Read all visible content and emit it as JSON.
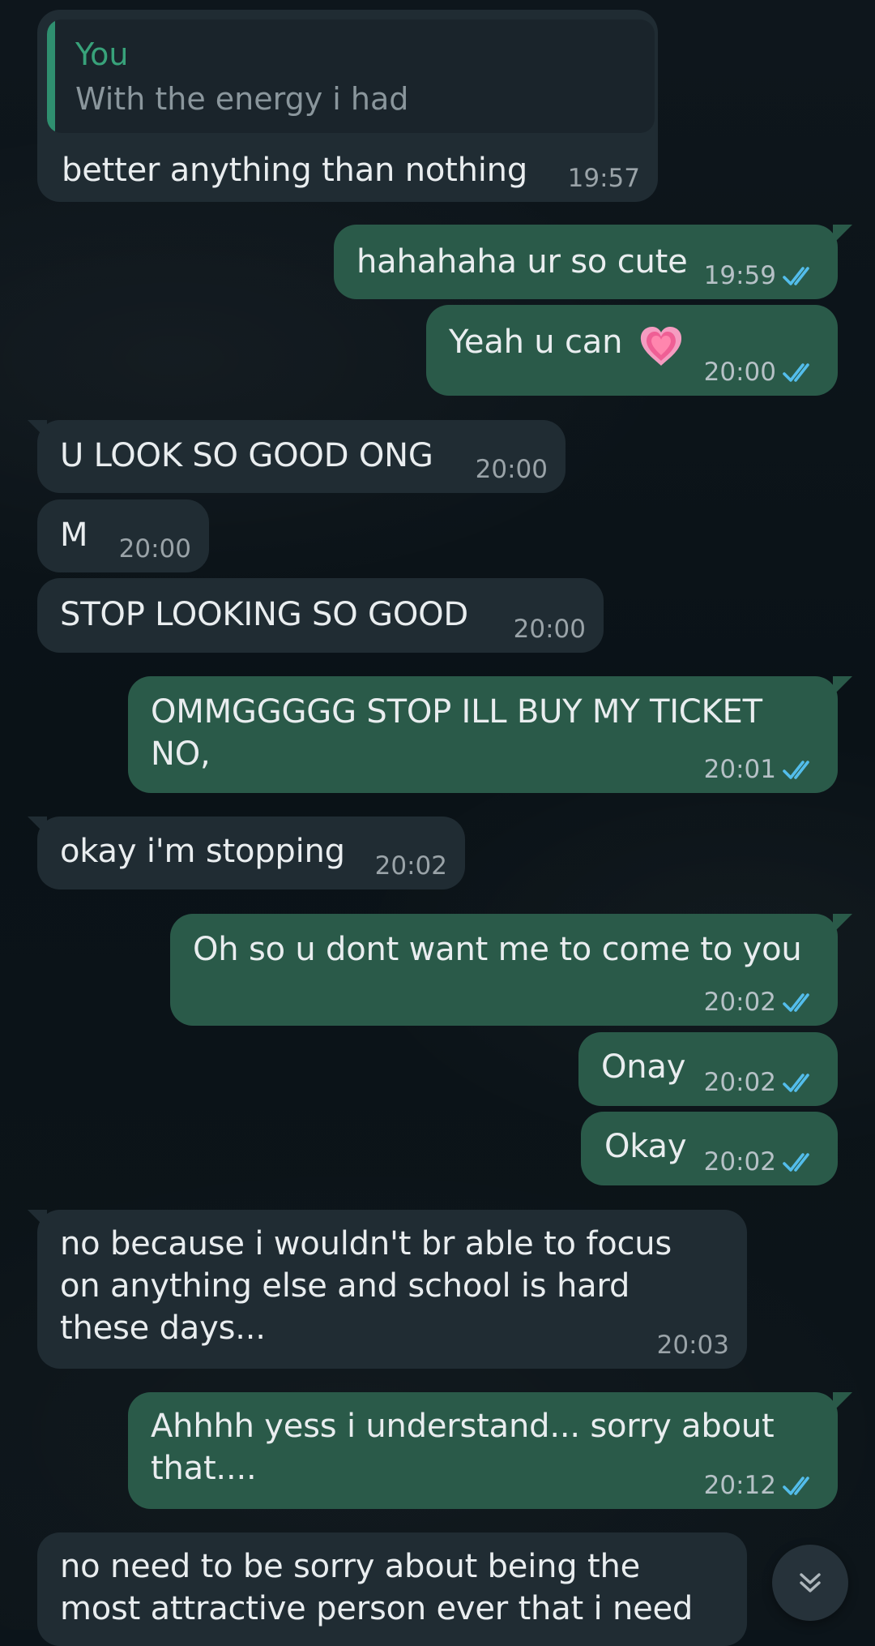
{
  "messages": [
    {
      "direction": "incoming",
      "reply": {
        "name": "You",
        "text": "With the energy i had"
      },
      "text": "better anything than nothing",
      "time": "19:57"
    },
    {
      "direction": "outgoing",
      "text": "hahahaha ur so cute",
      "time": "19:59",
      "status": "read"
    },
    {
      "direction": "outgoing",
      "text": "Yeah u can",
      "emoji": "growing-heart",
      "time": "20:00",
      "status": "read"
    },
    {
      "direction": "incoming",
      "text": "U LOOK SO GOOD ONG",
      "time": "20:00"
    },
    {
      "direction": "incoming",
      "text": "M",
      "time": "20:00"
    },
    {
      "direction": "incoming",
      "text": "STOP LOOKING SO GOOD",
      "time": "20:00"
    },
    {
      "direction": "outgoing",
      "text": "OMMGGGGG STOP ILL BUY MY TICKET\nNO,",
      "time": "20:01",
      "status": "read"
    },
    {
      "direction": "incoming",
      "text": "okay i'm stopping",
      "time": "20:02"
    },
    {
      "direction": "outgoing",
      "text": "Oh so u dont want me to come to you",
      "time": "20:02",
      "status": "read"
    },
    {
      "direction": "outgoing",
      "text": "Onay",
      "time": "20:02",
      "status": "read"
    },
    {
      "direction": "outgoing",
      "text": "Okay",
      "time": "20:02",
      "status": "read"
    },
    {
      "direction": "incoming",
      "text": "no because i wouldn't br able to focus\non anything else and school is hard\nthese days...",
      "time": "20:03"
    },
    {
      "direction": "outgoing",
      "text": "Ahhhh yess i understand... sorry about\nthat....",
      "time": "20:12",
      "status": "read"
    },
    {
      "direction": "incoming",
      "text": "no need to be sorry about being the\nmost attractive person ever that i need"
    }
  ],
  "ui": {
    "scroll_button_icon": "double-chevron-down-icon",
    "read_receipt_icon": "double-check-icon",
    "colors": {
      "incoming_bubble": "#202c33",
      "outgoing_bubble": "#2a5a49",
      "timestamp": "#b6c1c6",
      "read_ticks": "#53bdeb",
      "reply_name": "#38a27a"
    }
  }
}
